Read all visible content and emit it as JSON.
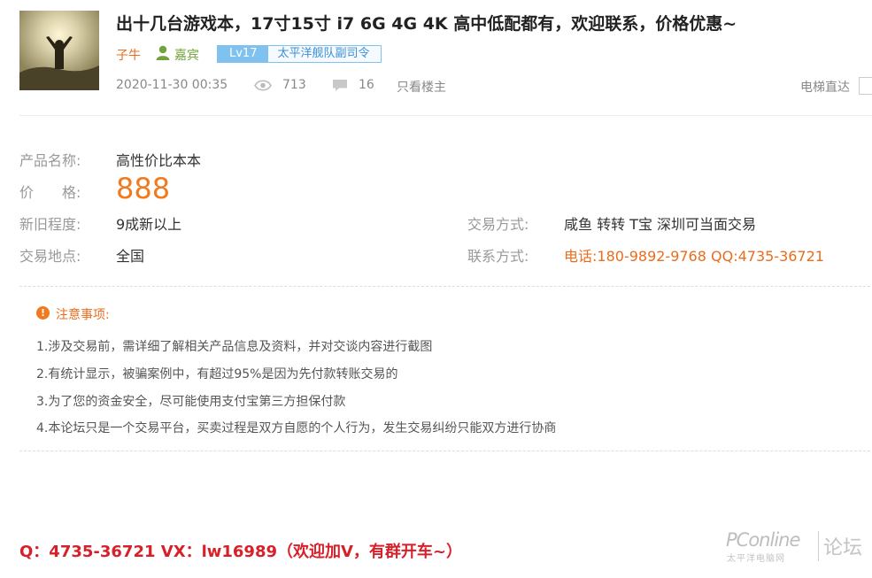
{
  "post": {
    "title": "出十几台游戏本，17寸15寸 i7 6G 4G 4K 高中低配都有，欢迎联系，价格优惠~",
    "author": "子牛",
    "role": "嘉宾",
    "level": "Lv17",
    "level_title": "太平洋舰队副司令",
    "date": "2020-11-30 00:35",
    "views": "713",
    "replies": "16",
    "only_op_label": "只看楼主",
    "elevator_label": "电梯直达"
  },
  "product": {
    "name_label": "产品名称:",
    "name_value": "高性价比本本",
    "price_label": "价　　格:",
    "price_value": "888",
    "condition_label": "新旧程度:",
    "condition_value": "9成新以上",
    "location_label": "交易地点:",
    "location_value": "全国",
    "trade_method_label": "交易方式:",
    "trade_method_value": "咸鱼 转转 T宝 深圳可当面交易",
    "contact_label": "联系方式:",
    "contact_value": "电话:180-9892-9768 QQ:4735-36721"
  },
  "notice": {
    "title": "注意事项:",
    "items": [
      "1.涉及交易前，需详细了解相关产品信息及资料，并对交谈内容进行截图",
      "2.有统计显示，被骗案例中，有超过95%是因为先付款转账交易的",
      "3.为了您的资金安全，尽可能使用支付宝第三方担保付款",
      "4.本论坛只是一个交易平台，买卖过程是双方自愿的个人行为，发生交易纠纷只能双方进行协商"
    ]
  },
  "footer_text": "Q：4735-36721  VX：lw16989（欢迎加V，有群开车~）",
  "watermark": {
    "brand": "PConline",
    "sub": "太平洋电脑网",
    "forum": "论坛"
  },
  "colors": {
    "accent_orange": "#f07a1d",
    "footer_red": "#d8202a",
    "level_blue": "#7fc1ef",
    "role_green": "#71a33a"
  },
  "icons": [
    "user-icon",
    "eye-icon",
    "comment-icon",
    "warning-icon"
  ]
}
